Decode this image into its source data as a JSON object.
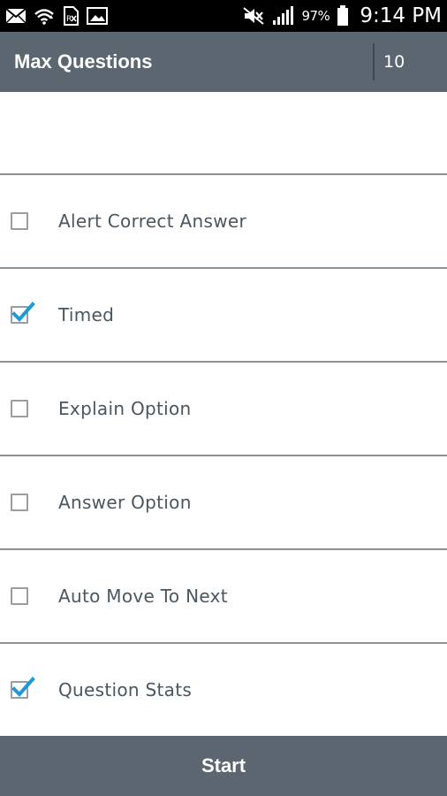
{
  "status_bar": {
    "battery_percent": "97%",
    "time": "9:14 PM",
    "left_icons": [
      "mail-icon",
      "wifi-icon",
      "silent-icon",
      "image-icon"
    ],
    "right_icons": [
      "mute-icon",
      "signal-icon",
      "battery-icon"
    ]
  },
  "header": {
    "title": "Max Questions",
    "max_questions_value": "10"
  },
  "options": [
    {
      "label": "Alert Correct Answer",
      "checked": false
    },
    {
      "label": "Timed",
      "checked": true
    },
    {
      "label": "Explain Option",
      "checked": false
    },
    {
      "label": "Answer Option",
      "checked": false
    },
    {
      "label": "Auto Move To Next",
      "checked": false
    },
    {
      "label": "Question Stats",
      "checked": true
    }
  ],
  "start_button": {
    "label": "Start"
  },
  "colors": {
    "toolbar": "#5b6670",
    "checkmark": "#1a9ad6",
    "label_text": "#4a5660",
    "divider": "#8c9398"
  }
}
